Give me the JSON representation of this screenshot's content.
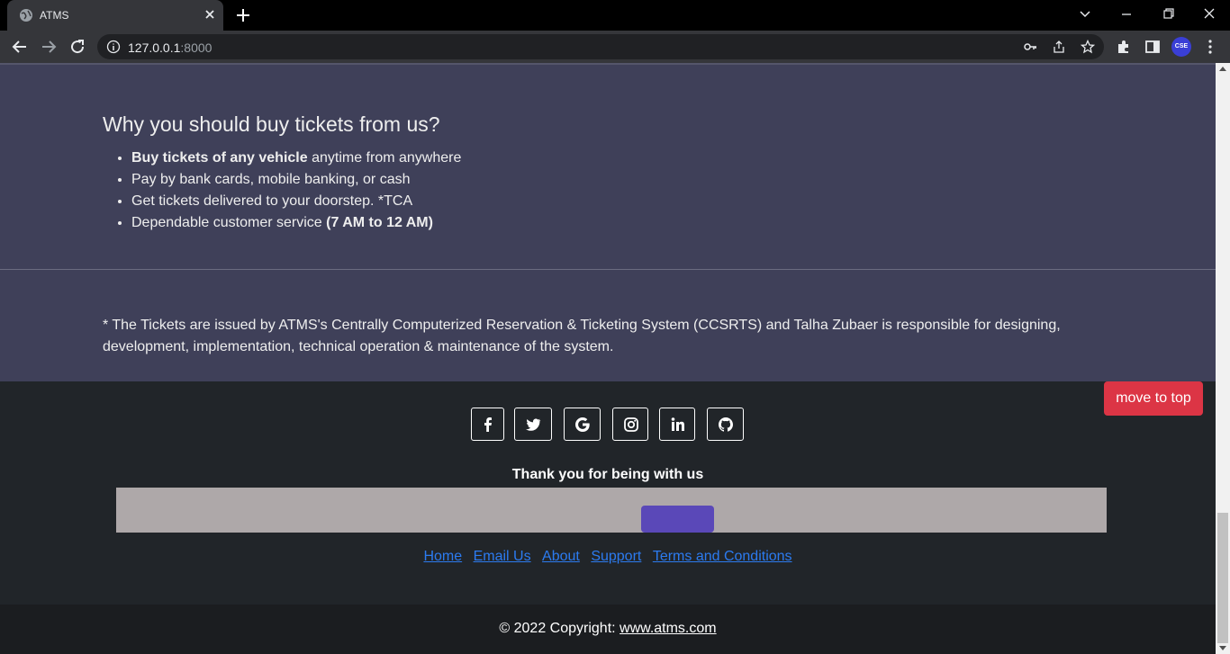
{
  "browser": {
    "tab_title": "ATMS",
    "url_host": "127.0.0.1",
    "url_port": ":8000",
    "profile_initials": "CSE"
  },
  "why": {
    "heading": "Why you should buy tickets from us?",
    "items": [
      {
        "bold": "Buy tickets of any vehicle",
        "text": " anytime from anywhere"
      },
      {
        "text": "Pay by bank cards, mobile banking, or cash"
      },
      {
        "text": "Get tickets delivered to your doorstep. *TCA"
      },
      {
        "text": "Dependable customer service ",
        "bold_after": "(7 AM to 12 AM)"
      }
    ]
  },
  "note": {
    "text": "* The Tickets are issued by ATMS's Centrally Computerized Reservation & Ticketing System (CCSRTS) and Talha Zubaer is responsible for designing, development, implementation, technical operation & maintenance of the system."
  },
  "footer": {
    "social": [
      "facebook-icon",
      "twitter-icon",
      "google-icon",
      "instagram-icon",
      "linkedin-icon",
      "github-icon"
    ],
    "thanks": "Thank you for being with us",
    "links": [
      "Home",
      "Email Us",
      "About",
      "Support",
      "Terms and Conditions"
    ],
    "copyright_prefix": "© 2022 Copyright: ",
    "copyright_link": "www.atms.com"
  },
  "move_to_top": "move to top",
  "colors": {
    "section_bg": "#3f4059",
    "footer_bg": "#212529",
    "danger": "#dc3545",
    "link": "#2c7bf0",
    "subscribe_btn": "#5a48b8"
  }
}
